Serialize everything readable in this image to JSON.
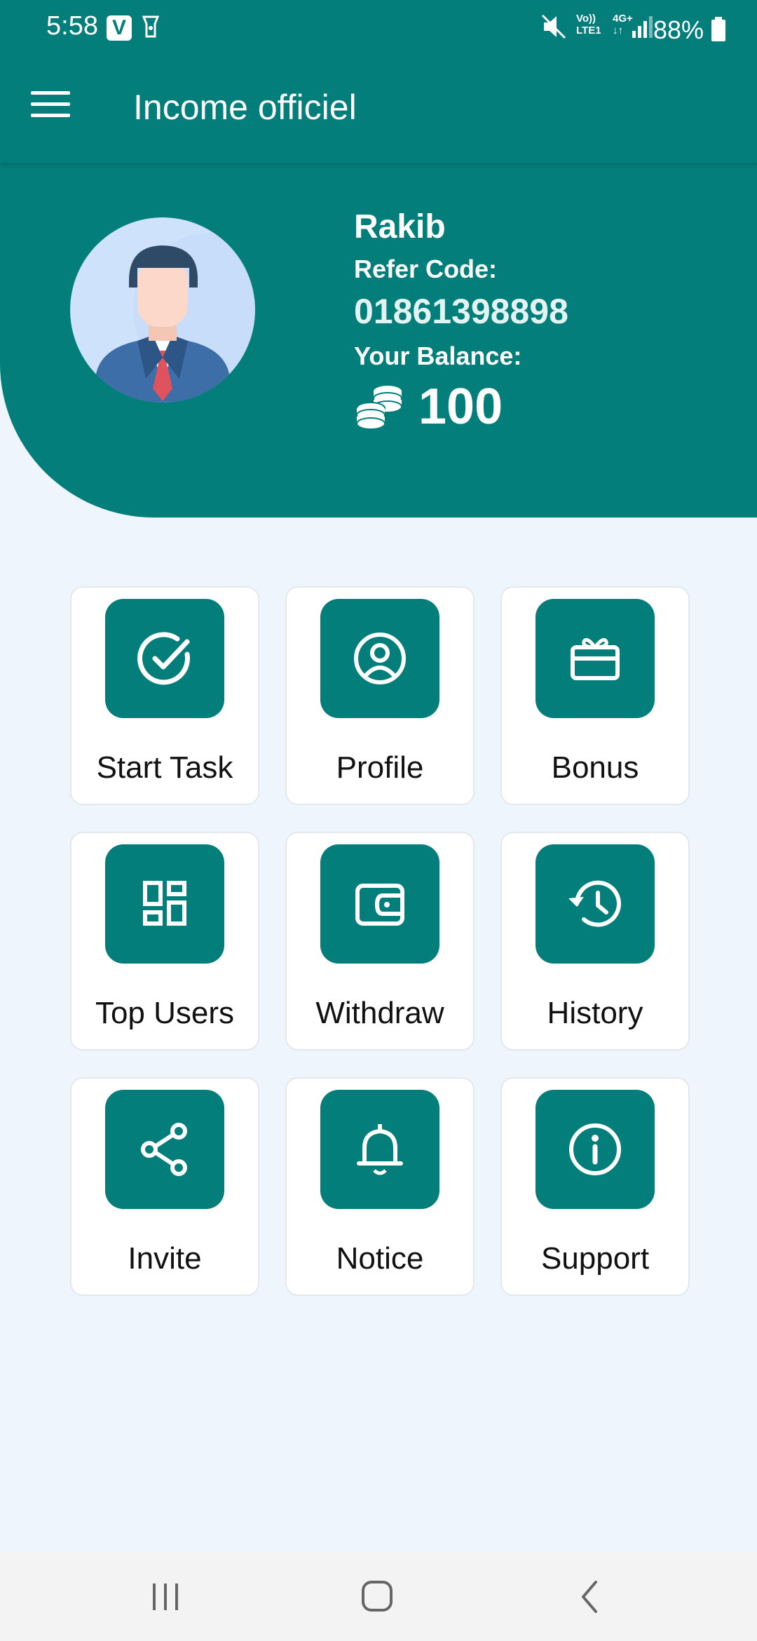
{
  "status_bar": {
    "time": "5:58",
    "v_icon_label": "V",
    "volte": "Vo))\nLTE1",
    "network": "4G+\n↓↑",
    "battery": "88%"
  },
  "app_bar": {
    "title": "Income officiel",
    "menu_icon": "hamburger-menu-icon"
  },
  "profile": {
    "name": "Rakib",
    "refer_label": "Refer Code:",
    "refer_code": "01861398898",
    "balance_label": "Your Balance:",
    "balance": "100",
    "avatar_icon": "businessman-avatar-icon",
    "coin_icon": "coin-stack-icon"
  },
  "menu": [
    {
      "label": "Start Task",
      "icon": "check-circle-icon"
    },
    {
      "label": "Profile",
      "icon": "user-circle-icon"
    },
    {
      "label": "Bonus",
      "icon": "gift-card-icon"
    },
    {
      "label": "Top Users",
      "icon": "dashboard-grid-icon"
    },
    {
      "label": "Withdraw",
      "icon": "wallet-icon"
    },
    {
      "label": "History",
      "icon": "history-clock-icon"
    },
    {
      "label": "Invite",
      "icon": "share-icon"
    },
    {
      "label": "Notice",
      "icon": "bell-icon"
    },
    {
      "label": "Support",
      "icon": "info-circle-icon"
    }
  ],
  "nav": {
    "recents_icon": "recents-icon",
    "home_icon": "home-icon",
    "back_icon": "back-icon"
  },
  "colors": {
    "primary": "#047e7a",
    "background": "#eef5fd",
    "card": "#ffffff",
    "navbar": "#f3f3f3"
  }
}
